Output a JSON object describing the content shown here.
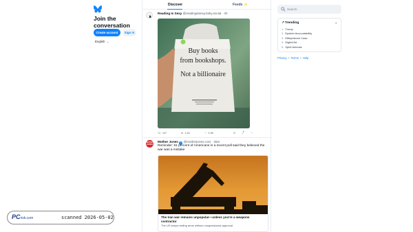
{
  "left": {
    "logo_icon": "butterfly-icon",
    "join_title": "Join the conversation",
    "create_account": "Create account",
    "sign_in": "Sign in",
    "language": "English",
    "language_caret": "⌄"
  },
  "tabs": {
    "discover": "Discover",
    "feeds": "Feeds ✨"
  },
  "post1": {
    "name": "Reading Is Sexy",
    "handle": "@readingissexy.bsky.social",
    "time": "· 4h",
    "image_text": {
      "line1": "Buy books",
      "line2": "from bookshops.",
      "line3": "Not a billionaire"
    },
    "replies": "147",
    "reposts": "1.4K",
    "likes": "3.9K"
  },
  "post2": {
    "name": "Mother Jones",
    "avatar_text": "MOTHER JONES",
    "handle": "@motherjones.com",
    "time": "· 35m",
    "text": "Reminder: 61 percent of Americans in a recent poll said they believed the war was a mistake",
    "card_title": "The Iran war remains unpopular—unless you're a weapons contractor",
    "card_desc": "The US keeps selling arms without congressional approval."
  },
  "right": {
    "search_placeholder": "Search",
    "trending_title": "Trending",
    "trending": [
      {
        "num": "1.",
        "label": "Trump"
      },
      {
        "num": "2.",
        "label": "Epstein Accountability"
      },
      {
        "num": "3.",
        "label": "Mifepristone Case"
      },
      {
        "num": "4.",
        "label": "Digital Art"
      },
      {
        "num": "5.",
        "label": "Spirit Animals"
      }
    ],
    "footer": {
      "privacy": "Privacy",
      "terms": "Terms",
      "help": "Help",
      "dot": "•"
    }
  },
  "watermark": {
    "logo_pc": "PC",
    "logo_risk": "risk.com",
    "text": "scanned 2026-05-02"
  },
  "colors": {
    "accent": "#1083fe",
    "border": "#e8edf2",
    "muted": "#55606b"
  }
}
